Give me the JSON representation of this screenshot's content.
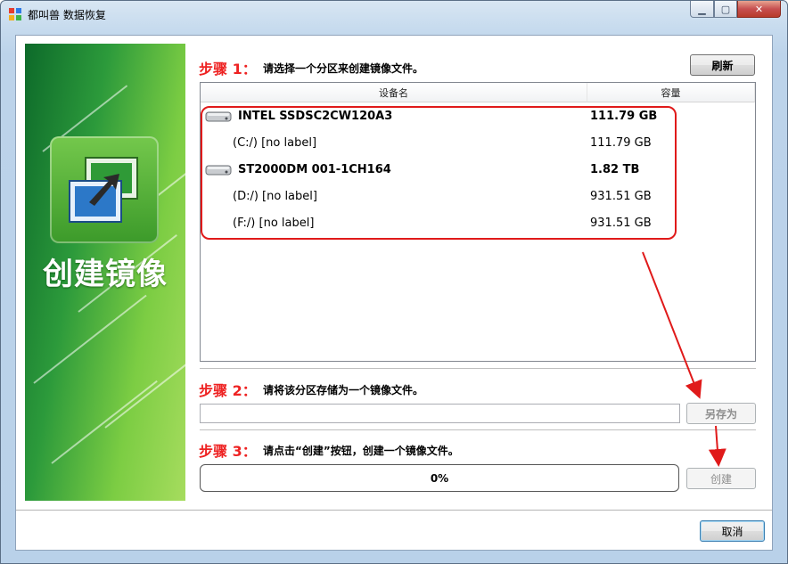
{
  "window": {
    "title": "都叫兽 数据恢复",
    "controls": {
      "minimize": "▁",
      "maximize": "▢",
      "close": "✕"
    }
  },
  "banner": {
    "title": "创建镜像"
  },
  "step1": {
    "label": "步骤 1：",
    "text": "请选择一个分区来创建镜像文件。",
    "refresh_label": "刷新"
  },
  "list": {
    "columns": [
      "设备名",
      "容量"
    ],
    "rows": [
      {
        "type": "disk",
        "name": "INTEL SSDSC2CW120A3",
        "capacity": "111.79 GB"
      },
      {
        "type": "partition",
        "name": "(C:/) [no label]",
        "capacity": "111.79 GB"
      },
      {
        "type": "disk",
        "name": "ST2000DM 001-1CH164",
        "capacity": "1.82 TB"
      },
      {
        "type": "partition",
        "name": "(D:/) [no label]",
        "capacity": "931.51 GB"
      },
      {
        "type": "partition",
        "name": "(F:/) [no label]",
        "capacity": "931.51 GB"
      }
    ]
  },
  "step2": {
    "label": "步骤 2：",
    "text": "请将该分区存储为一个镜像文件。",
    "path_value": "",
    "save_as_label": "另存为"
  },
  "step3": {
    "label": "步骤 3：",
    "text": "请点击“创建”按钮，创建一个镜像文件。",
    "progress_text": "0%",
    "progress": 0,
    "create_label": "创建"
  },
  "footer": {
    "cancel_label": "取消"
  },
  "colors": {
    "accent_red": "#ee2222",
    "highlight_red": "#e01a1a",
    "banner_green": "#2c9a3b"
  },
  "icons": {
    "app": "app-logo-icon",
    "disk": "hard-disk-icon",
    "banner": "disk-image-icon"
  }
}
